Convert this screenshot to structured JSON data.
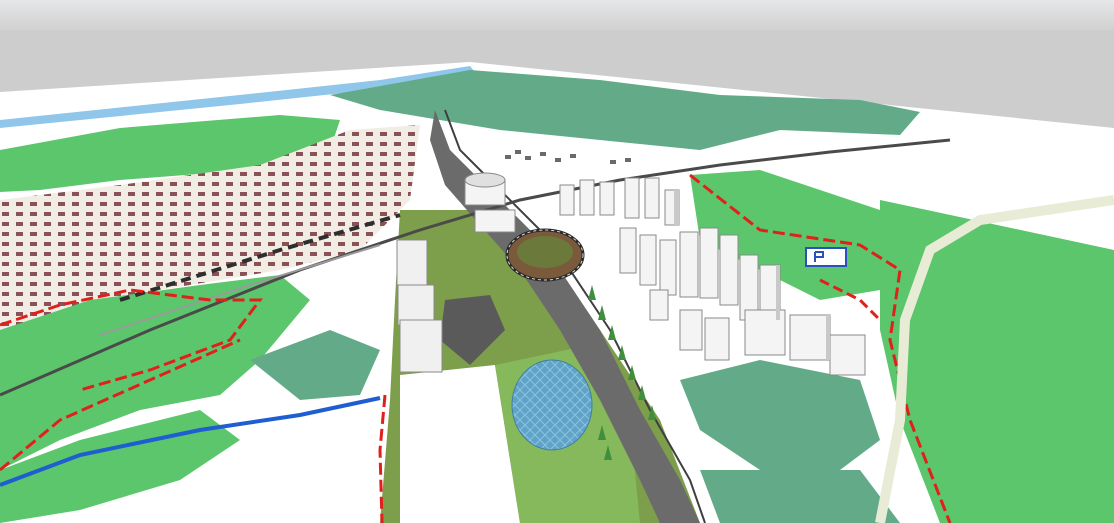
{
  "scene": {
    "kind": "3D urban masterplan rendering (perspective view)",
    "colors": {
      "sky_top": "#e6e7e8",
      "sky_bottom": "#cdcdcd",
      "ground_base": "#ffffff",
      "forest_green": "#5bc66b",
      "park_green": "#63ab88",
      "lawn_olive": "#7d9e4a",
      "urban_beige": "#f1ede4",
      "roof_maroon": "#8a5257",
      "river_blue": "#8fc6ea",
      "blue_route": "#1f5ed1",
      "red_boundary": "#e0201b",
      "road_grey": "#6b6b6b",
      "road_dark": "#3f3f3f",
      "building_white": "#f4f4f4",
      "building_shadow": "#c9c9c9",
      "pond_blue": "#5fa3c8"
    },
    "icons": [
      "tower-icon",
      "stadium-ring-icon",
      "round-pond-icon",
      "parking-sign-icon"
    ]
  }
}
